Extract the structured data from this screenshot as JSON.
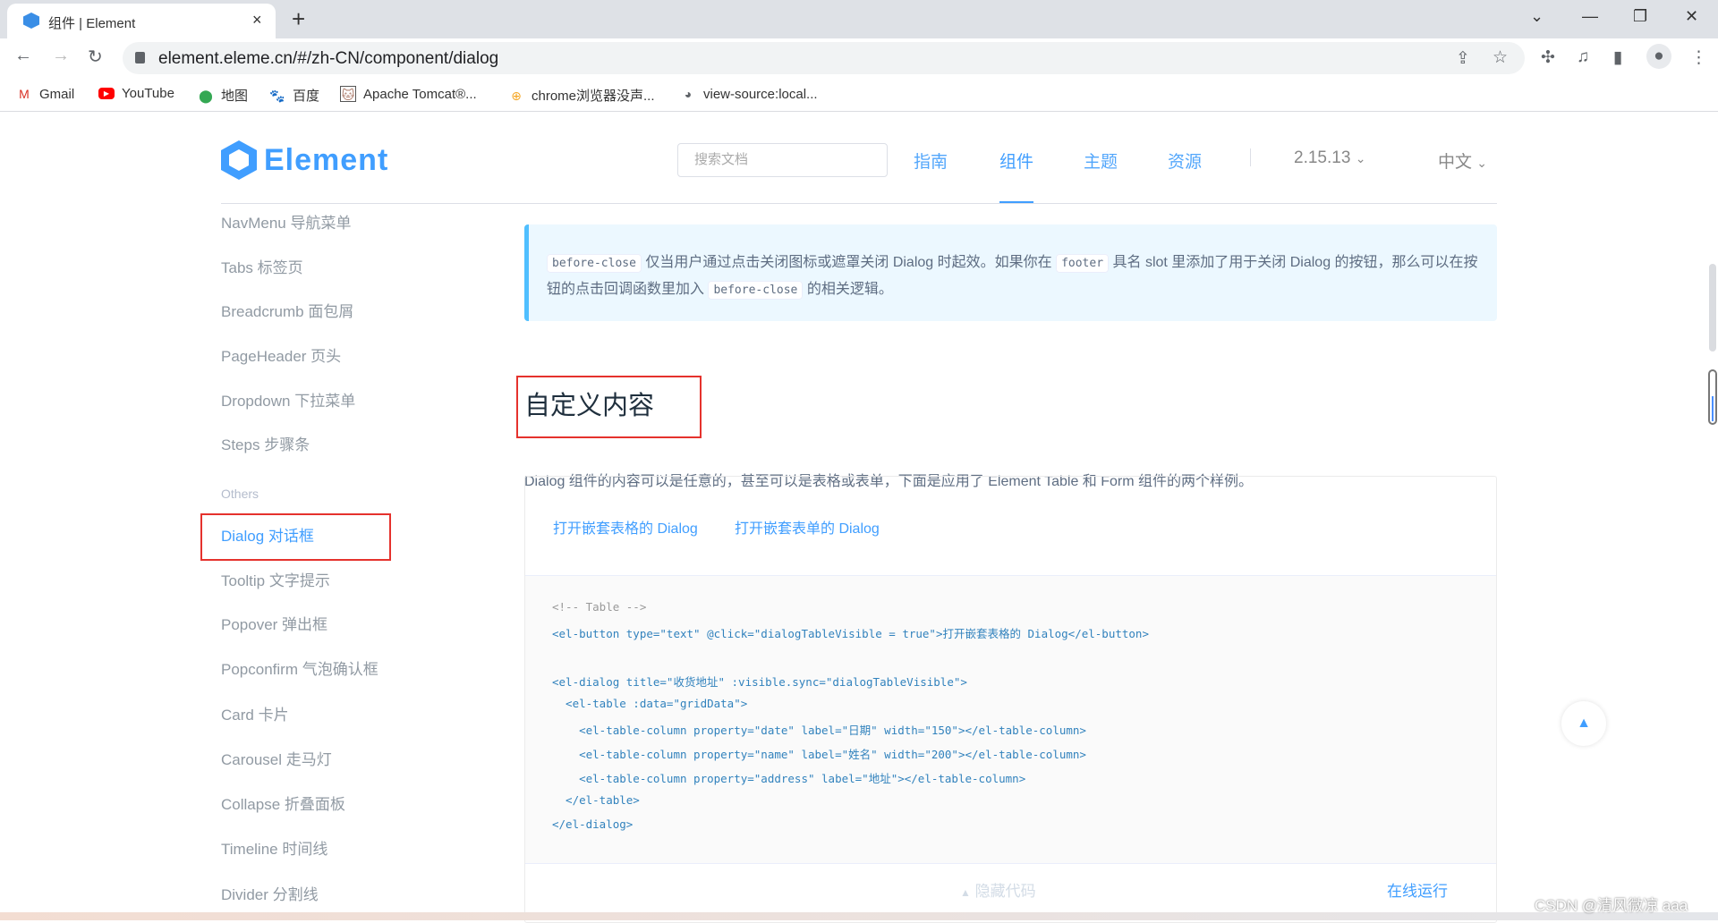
{
  "browser": {
    "tab_title": "组件 | Element",
    "tab_close": "×",
    "new_tab": "+",
    "url": "element.eleme.cn/#/zh-CN/component/dialog",
    "bookmarks": [
      {
        "label": "Gmail",
        "icon": "gmail-icon"
      },
      {
        "label": "YouTube",
        "icon": "youtube-icon"
      },
      {
        "label": "地图",
        "icon": "maps-icon"
      },
      {
        "label": "百度",
        "icon": "baidu-icon"
      },
      {
        "label": "Apache Tomcat®...",
        "icon": "tomcat-icon"
      },
      {
        "label": "chrome浏览器没声...",
        "icon": "site-icon"
      },
      {
        "label": "view-source:local...",
        "icon": "globe-icon"
      }
    ]
  },
  "header": {
    "logo": "Element",
    "search_placeholder": "搜索文档",
    "nav": [
      "指南",
      "组件",
      "主题",
      "资源"
    ],
    "version": "2.15.13",
    "language": "中文"
  },
  "sidebar": {
    "items_top": [
      "NavMenu 导航菜单",
      "Tabs 标签页",
      "Breadcrumb 面包屑",
      "PageHeader 页头",
      "Dropdown 下拉菜单",
      "Steps 步骤条"
    ],
    "group": "Others",
    "items_bottom": [
      "Dialog 对话框",
      "Tooltip 文字提示",
      "Popover 弹出框",
      "Popconfirm 气泡确认框",
      "Card 卡片",
      "Carousel 走马灯",
      "Collapse 折叠面板",
      "Timeline 时间线",
      "Divider 分割线"
    ]
  },
  "main": {
    "tip": {
      "code1": "before-close",
      "t1": " 仅当用户通过点击关闭图标或遮罩关闭 Dialog 时起效。如果你在 ",
      "code2": "footer",
      "t2": " 具名 slot 里添加了用于关闭 Dialog 的按钮，那么可以在按钮的点击回调函数里加入 ",
      "code3": "before-close",
      "t3": " 的相关逻辑。"
    },
    "heading": "自定义内容",
    "paragraph": "Dialog 组件的内容可以是任意的，甚至可以是表格或表单，下面是应用了 Element Table 和 Form 组件的两个样例。",
    "demo_links": [
      "打开嵌套表格的 Dialog",
      "打开嵌套表单的 Dialog"
    ],
    "code_lines": [
      "<!-- Table -->",
      "<el-button type=\"text\" @click=\"dialogTableVisible = true\">打开嵌套表格的 Dialog</el-button>",
      "",
      "<el-dialog title=\"收货地址\" :visible.sync=\"dialogTableVisible\">",
      "  <el-table :data=\"gridData\">",
      "    <el-table-column property=\"date\" label=\"日期\" width=\"150\"></el-table-column>",
      "    <el-table-column property=\"name\" label=\"姓名\" width=\"200\"></el-table-column>",
      "    <el-table-column property=\"address\" label=\"地址\"></el-table-column>",
      "  </el-table>",
      "</el-dialog>"
    ],
    "hide_code": "隐藏代码",
    "run_online": "在线运行"
  },
  "watermark": "CSDN @清风微凉 aaa",
  "colors": {
    "brand": "#409eff",
    "highlight_box": "#e5322d"
  }
}
